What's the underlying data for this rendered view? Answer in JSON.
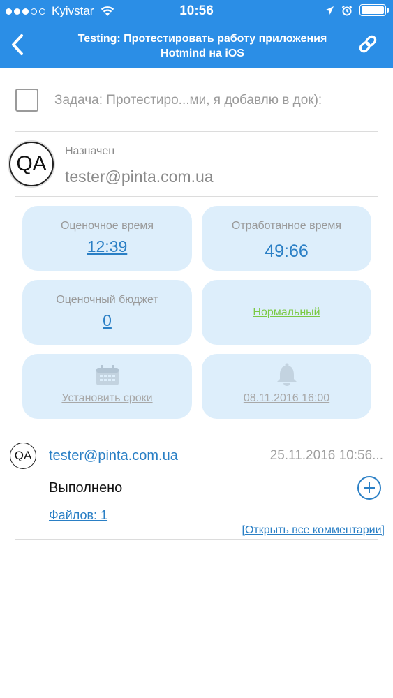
{
  "status_bar": {
    "carrier": "Kyivstar",
    "time": "10:56",
    "icons": [
      "signal-dots",
      "wifi-icon",
      "location-icon",
      "alarm-icon",
      "battery-icon"
    ]
  },
  "nav": {
    "title_line1": "Testing: Протестировать работу приложения",
    "title_line2": "Hotmind на iOS",
    "back_icon": "chevron-left-icon",
    "link_icon": "link-icon"
  },
  "task": {
    "text": "Задача: Протестиро...ми, я добавлю в док):",
    "checked": false
  },
  "assigned": {
    "avatar_initials": "QA",
    "label": "Назначен",
    "email": "tester@pinta.com.ua"
  },
  "cards": {
    "estimated_time": {
      "label": "Оценочное время",
      "value": "12:39"
    },
    "worked_time": {
      "label": "Отработанное время",
      "value": "49:66"
    },
    "estimated_budget": {
      "label": "Оценочный бюджет",
      "value": "0"
    },
    "priority": {
      "value": "Нормальный"
    },
    "deadline": {
      "icon": "calendar-icon",
      "label": "Установить сроки"
    },
    "reminder": {
      "icon": "bell-icon",
      "label": "08.11.2016 16:00"
    }
  },
  "comment": {
    "avatar_initials": "QA",
    "author": "tester@pinta.com.ua",
    "date": "25.11.2016 10:56...",
    "text": "Выполнено",
    "files": "Файлов: 1",
    "open_all": "[Открыть все комментарии]"
  },
  "colors": {
    "header": "#2b8ee6",
    "card_bg": "#ddeefb",
    "link": "#2a7fc5",
    "green": "#7ac943"
  }
}
